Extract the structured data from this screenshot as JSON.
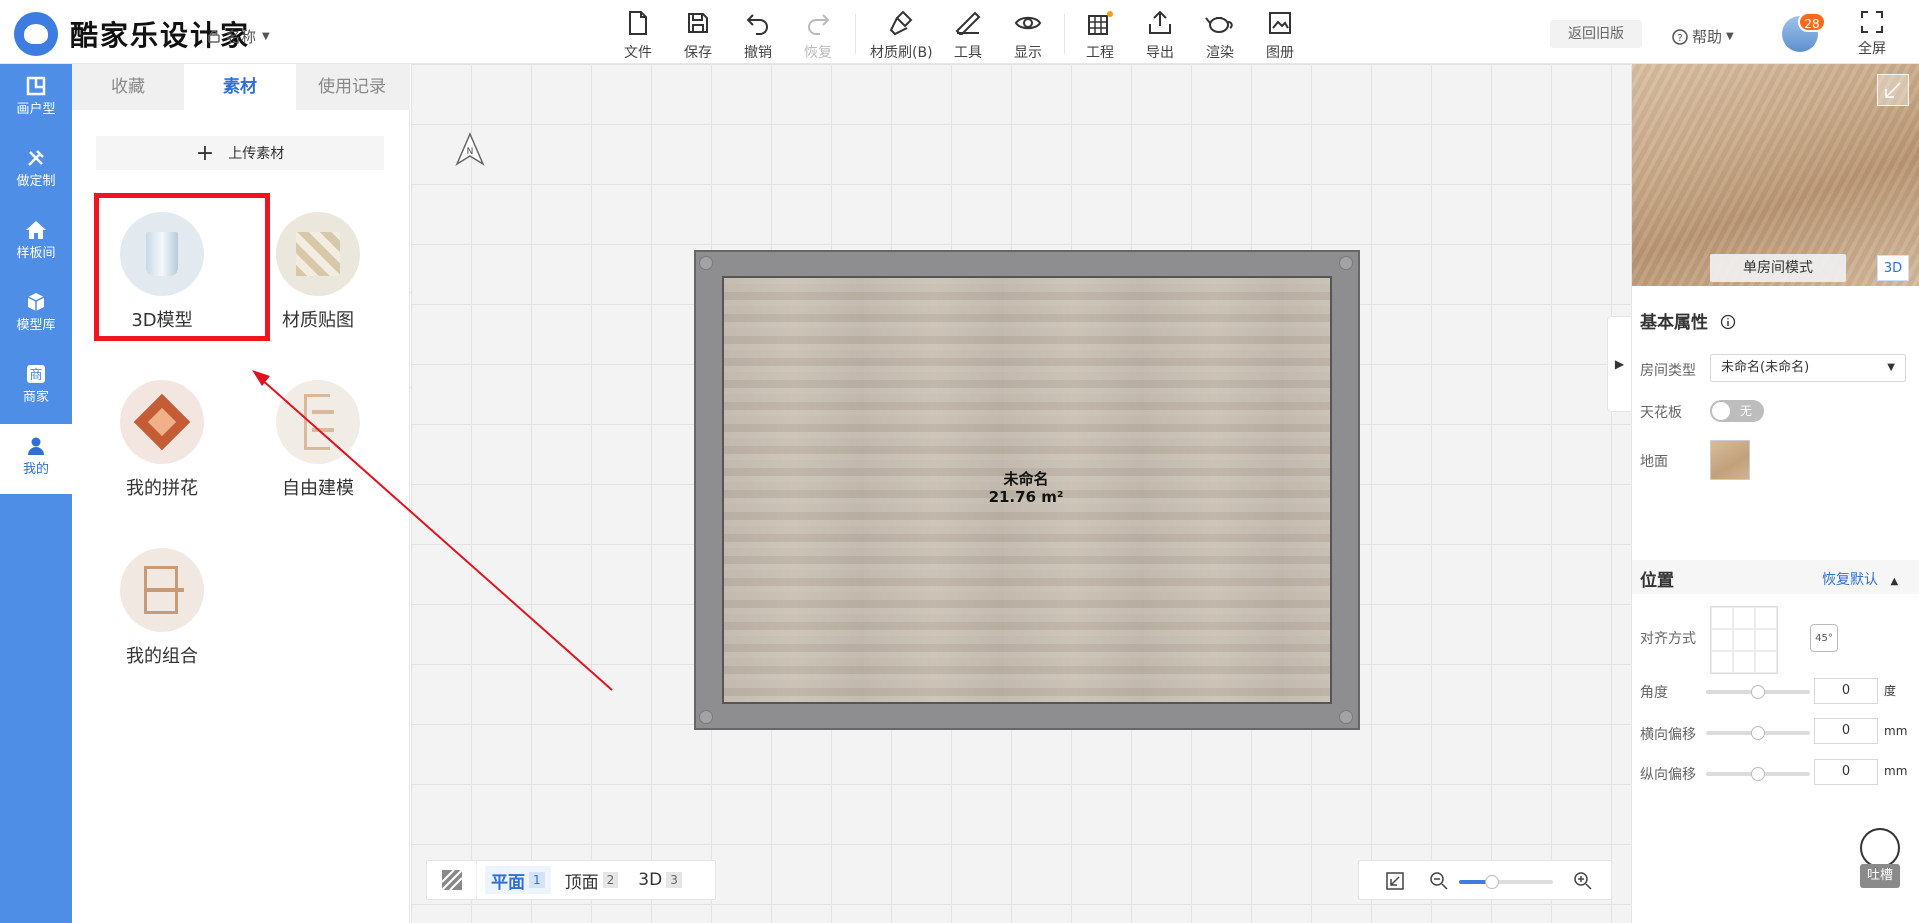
{
  "header": {
    "app_name": "酷家乐设计家",
    "project_name": "名称",
    "tools": [
      {
        "label": "文件",
        "icon": "file-icon"
      },
      {
        "label": "保存",
        "icon": "save-icon"
      },
      {
        "label": "撤销",
        "icon": "undo-icon"
      },
      {
        "label": "恢复",
        "icon": "redo-icon"
      },
      {
        "label": "材质刷(B)",
        "icon": "brush-icon"
      },
      {
        "label": "工具",
        "icon": "ruler-icon"
      },
      {
        "label": "显示",
        "icon": "eye-icon"
      },
      {
        "label": "工程",
        "icon": "project-icon"
      },
      {
        "label": "导出",
        "icon": "export-icon"
      },
      {
        "label": "渲染",
        "icon": "teapot-icon"
      },
      {
        "label": "图册",
        "icon": "album-icon"
      }
    ],
    "return_old": "返回旧版",
    "help": "帮助",
    "badge_count": "28",
    "fullscreen": "全屏"
  },
  "leftnav": {
    "items": [
      {
        "label": "画户型",
        "icon": "floorplan-icon"
      },
      {
        "label": "做定制",
        "icon": "tools-icon"
      },
      {
        "label": "样板间",
        "icon": "home-icon"
      },
      {
        "label": "模型库",
        "icon": "cube-icon"
      },
      {
        "label": "商家",
        "icon": "shop-icon"
      },
      {
        "label": "我的",
        "icon": "user-icon"
      }
    ]
  },
  "material_panel": {
    "tabs": [
      "收藏",
      "素材",
      "使用记录"
    ],
    "upload_label": "上传素材",
    "categories": [
      "3D模型",
      "材质贴图",
      "我的拼花",
      "自由建模",
      "我的组合"
    ]
  },
  "canvas": {
    "compass": "N",
    "room_name": "未命名",
    "room_area": "21.76 m²",
    "views": [
      {
        "label": "平面",
        "key": "1"
      },
      {
        "label": "顶面",
        "key": "2"
      },
      {
        "label": "3D",
        "key": "3"
      }
    ],
    "zoom_level": 0.35
  },
  "right_panel": {
    "preview_mode": "单房间模式",
    "preview_3d": "3D",
    "basic_title": "基本属性",
    "room_type_label": "房间类型",
    "room_type_value": "未命名(未命名)",
    "ceiling_label": "天花板",
    "ceiling_toggle": "无",
    "floor_label": "地面",
    "position_title": "位置",
    "reset_default": "恢复默认",
    "align_label": "对齐方式",
    "rotate_label": "45°",
    "angle_label": "角度",
    "angle_value": "0",
    "angle_unit": "度",
    "h_offset_label": "横向偏移",
    "h_offset_value": "0",
    "h_offset_unit": "mm",
    "v_offset_label": "纵向偏移",
    "v_offset_value": "0",
    "v_offset_unit": "mm"
  },
  "feedback_label": "吐槽",
  "colors": {
    "accent": "#2f6fd6",
    "nav_bg": "#4f8ee6",
    "highlight": "#f0141e"
  }
}
